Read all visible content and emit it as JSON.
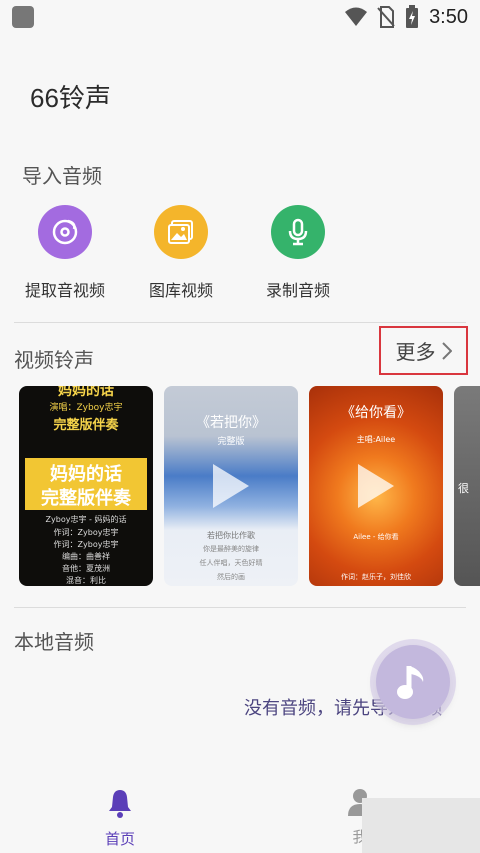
{
  "status_bar": {
    "time": "3:50",
    "icons": [
      "app-notification-icon",
      "wifi-icon",
      "no-sim-icon",
      "battery-charging-icon"
    ]
  },
  "app": {
    "title": "66铃声"
  },
  "import_section": {
    "title": "导入音频",
    "items": [
      {
        "label": "提取音视频",
        "icon": "music-disc-icon",
        "color": "#a36be0"
      },
      {
        "label": "图库视频",
        "icon": "gallery-icon",
        "color": "#f4b52b"
      },
      {
        "label": "录制音频",
        "icon": "microphone-icon",
        "color": "#35b36b"
      }
    ]
  },
  "video_section": {
    "title": "视频铃声",
    "more_label": "更多",
    "cards": [
      {
        "top_text": "妈妈的话",
        "line1": "演唱：Zyboy忠宇",
        "line2": "完整版伴奏",
        "banner1": "妈妈的话",
        "banner2": "完整版伴奏",
        "credits": [
          "Zyboy忠宇 - 妈妈的话",
          "作词：Zyboy忠宇",
          "作词：Zyboy忠宇",
          "编曲：曲善祥",
          "音他：夏茂洲",
          "混音：利比"
        ]
      },
      {
        "title": "《若把你》",
        "subtitle": "完整版",
        "credits": [
          "若把你比作歌",
          "你是最醉美的旋律",
          "任人伴唱，天色好晴",
          "然后的画"
        ]
      },
      {
        "title": "《给你看》",
        "subtitle": "主唱:Ailee",
        "credits": [
          "Ailee - 给你看",
          "作词：赵乐子，刘佳欣"
        ]
      },
      {
        "partial_text": "很"
      }
    ]
  },
  "local_section": {
    "title": "本地音频",
    "empty_message": "没有音频，请先导入音频"
  },
  "fab": {
    "icon": "music-note-icon"
  },
  "bottom_nav": {
    "items": [
      {
        "label": "首页",
        "icon": "bell-icon",
        "active": true,
        "color": "#5b3fb8"
      },
      {
        "label": "我",
        "icon": "person-icon",
        "active": false,
        "color": "#999999"
      }
    ]
  }
}
